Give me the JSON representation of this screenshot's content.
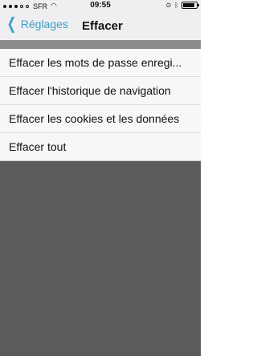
{
  "status_bar": {
    "carrier": "SFR",
    "time": "09:55",
    "icons": [
      "signal-icon",
      "wifi-icon",
      "rotation-lock-icon",
      "bluetooth-icon",
      "battery-icon"
    ]
  },
  "nav": {
    "back_label": "Réglages",
    "title": "Effacer"
  },
  "menu": {
    "items": [
      {
        "label": "Effacer les mots de passe enregi..."
      },
      {
        "label": "Effacer l'historique de navigation"
      },
      {
        "label": "Effacer les cookies et les données"
      },
      {
        "label": "Effacer tout"
      }
    ]
  },
  "colors": {
    "accent": "#3aa0c5",
    "overlay": "#5b5b5b"
  }
}
